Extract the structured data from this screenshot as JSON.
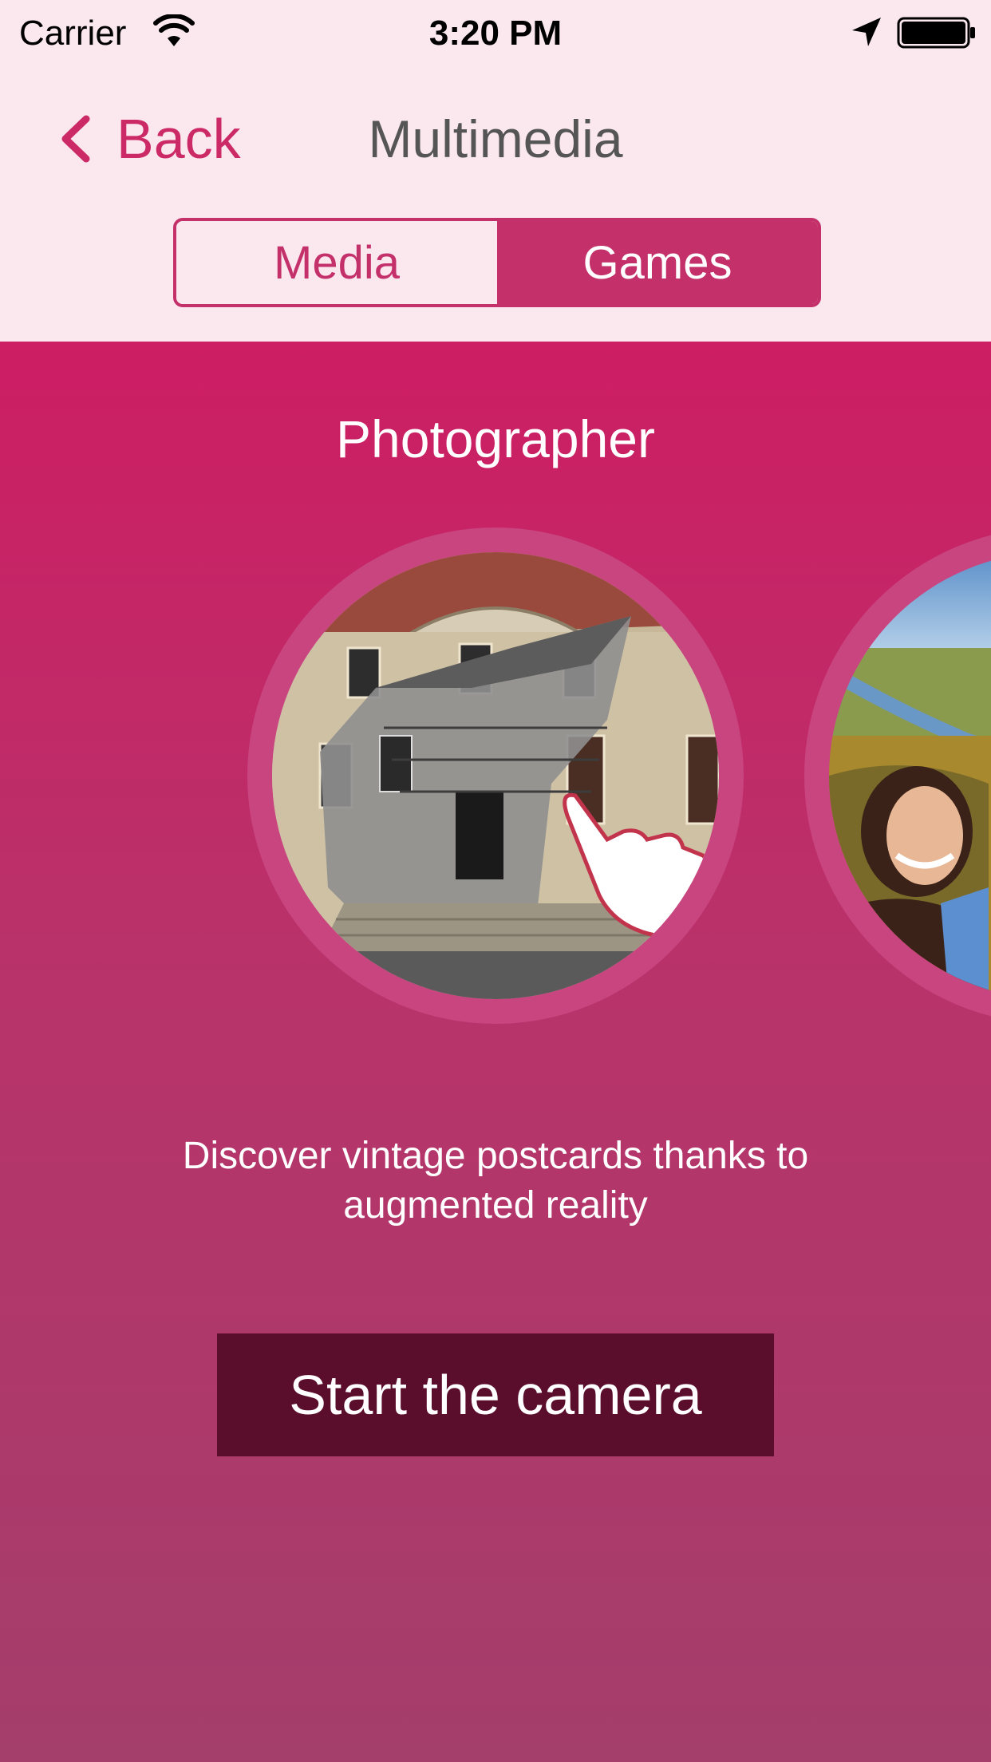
{
  "status_bar": {
    "carrier": "Carrier",
    "time": "3:20 PM"
  },
  "nav": {
    "back_label": "Back",
    "title": "Multimedia"
  },
  "segments": [
    {
      "label": "Media",
      "selected": false
    },
    {
      "label": "Games",
      "selected": true
    }
  ],
  "activity": {
    "title": "Photographer",
    "description": "Discover vintage postcards thanks to augmented reality",
    "button_label": "Start the camera"
  },
  "colors": {
    "accent": "#cc2a66",
    "header_background": "#fbe8ef",
    "content_gradient_top": "#cd1d63",
    "content_gradient_bottom": "#a43e6b",
    "button_background": "#5b0d2c"
  },
  "icons": {
    "back": "chevron-left-icon",
    "wifi": "wifi-icon",
    "location": "location-arrow-icon",
    "battery": "battery-icon",
    "gesture": "pointing-hand-icon"
  }
}
